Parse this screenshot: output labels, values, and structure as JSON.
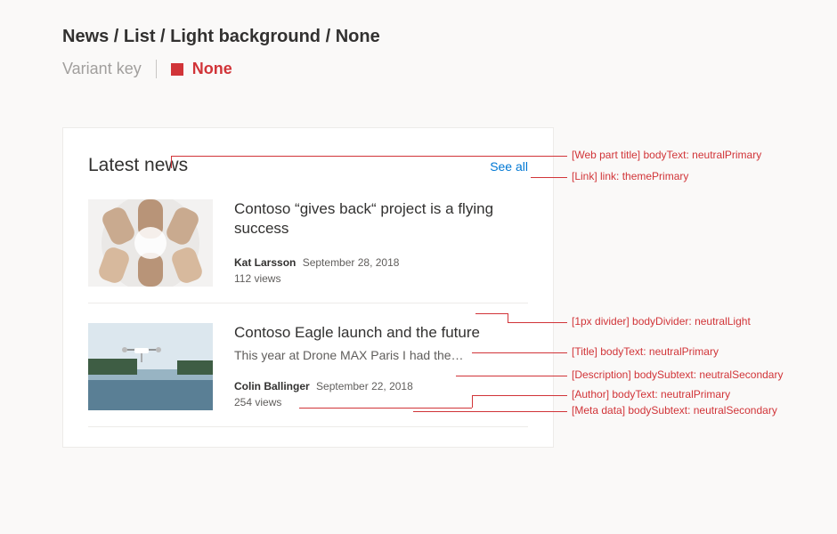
{
  "header": {
    "breadcrumb": "News / List / Light background / None",
    "variant_key_label": "Variant key",
    "variant_name": "None"
  },
  "card": {
    "title": "Latest news",
    "see_all": "See all",
    "items": [
      {
        "title": "Contoso “gives back“ project is a flying success",
        "description": "",
        "author": "Kat Larsson",
        "date": "September 28, 2018",
        "views": "112 views"
      },
      {
        "title": "Contoso Eagle launch and the future",
        "description": "This year at Drone MAX Paris I had the…",
        "author": "Colin Ballinger",
        "date": "September 22, 2018",
        "views": "254 views"
      }
    ]
  },
  "annotations": {
    "web_part_title": "[Web part title] bodyText: neutralPrimary",
    "link": "[Link] link: themePrimary",
    "divider": "[1px divider] bodyDivider: neutralLight",
    "title": "[Title] bodyText: neutralPrimary",
    "description": "[Description] bodySubtext: neutralSecondary",
    "author": "[Author] bodyText: neutralPrimary",
    "metadata": "[Meta data] bodySubtext: neutralSecondary"
  }
}
